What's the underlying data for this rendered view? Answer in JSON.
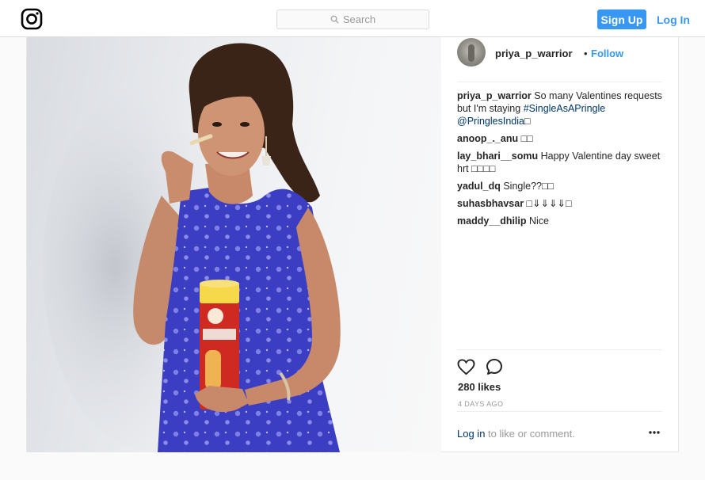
{
  "nav": {
    "logo_icon": "instagram-camera-icon",
    "search_placeholder": "Search",
    "signup_label": "Sign Up",
    "login_label": "Log In"
  },
  "post": {
    "username": "priya_p_warrior",
    "separator": "•",
    "follow_label": "Follow",
    "caption": {
      "user": "priya_p_warrior",
      "text": " So many Valentines requests but I'm staying ",
      "hashtag": "#SingleAsAPringle",
      "mention": "@PringlesIndia",
      "emoji": "□"
    },
    "comments": [
      {
        "user": "anoop_._anu",
        "text": " □□"
      },
      {
        "user": "lay_bhari__somu",
        "text": " Happy Valentine day sweet hrt □□□□"
      },
      {
        "user": "yadul_dq",
        "text": " Single??□□"
      },
      {
        "user": "suhasbhavsar",
        "text": " □⇓⇓⇓⇓□"
      },
      {
        "user": "maddy__dhilip",
        "text": " Nice"
      }
    ],
    "likes": "280 likes",
    "time": "4 DAYS AGO",
    "login_link": "Log in",
    "login_suffix": " to like or comment.",
    "more_icon": "ellipsis-icon"
  },
  "colors": {
    "accent": "#3897f0",
    "link": "#003569",
    "muted": "#999999",
    "border": "#dbdbdb"
  }
}
